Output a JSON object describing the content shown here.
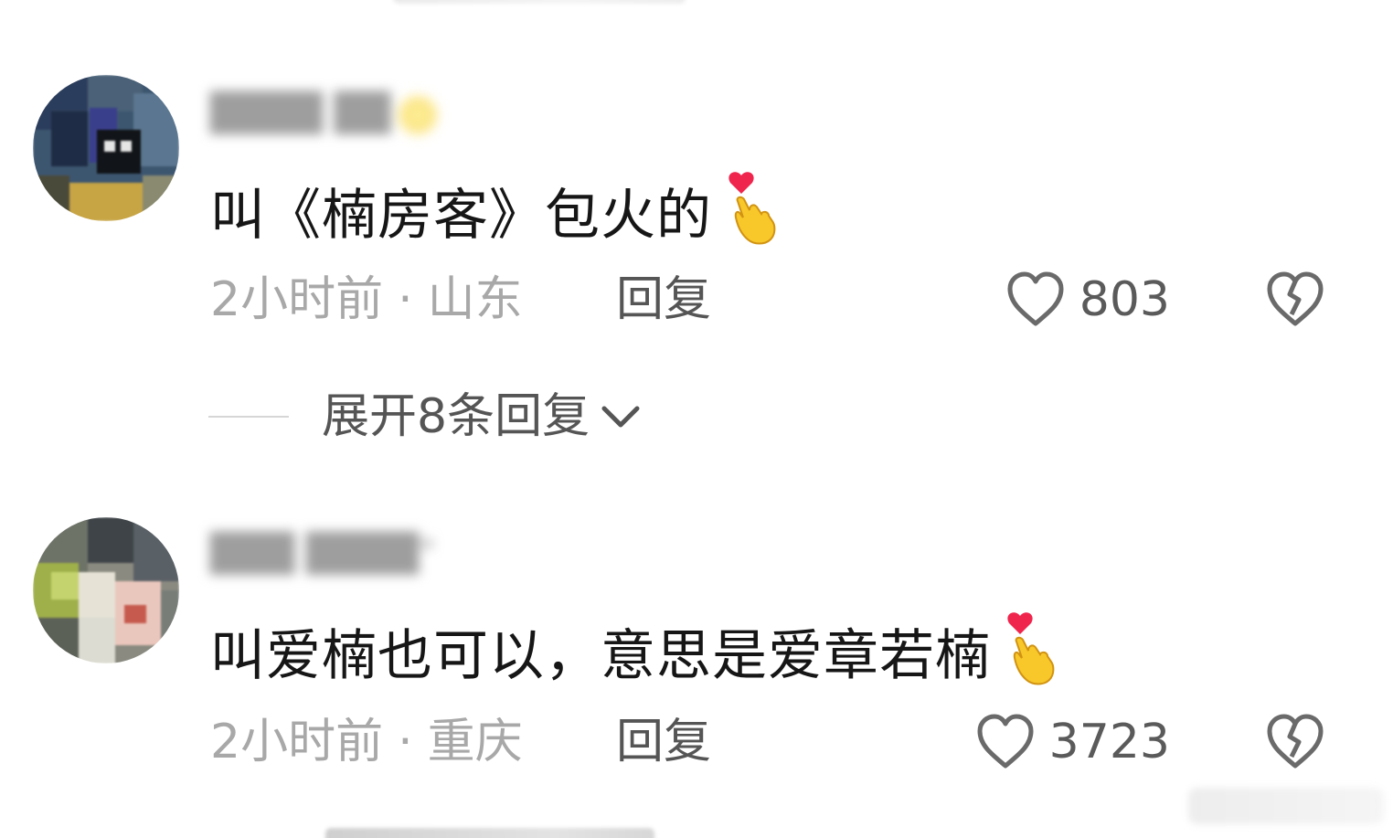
{
  "comments": [
    {
      "text": "叫《楠房客》包火的",
      "emoji": "heart-finger-emoji",
      "time": "2小时前",
      "location": "山东",
      "reply_label": "回复",
      "likes": "803",
      "expand_label": "展开8条回复"
    },
    {
      "text": "叫爱楠也可以，意思是爱章若楠",
      "emoji": "heart-finger-emoji",
      "time": "2小时前",
      "location": "重庆",
      "reply_label": "回复",
      "likes": "3723"
    }
  ],
  "colors": {
    "text_primary": "#161616",
    "text_meta": "#a8a8a8",
    "text_action": "#555555",
    "background": "#ffffff"
  }
}
